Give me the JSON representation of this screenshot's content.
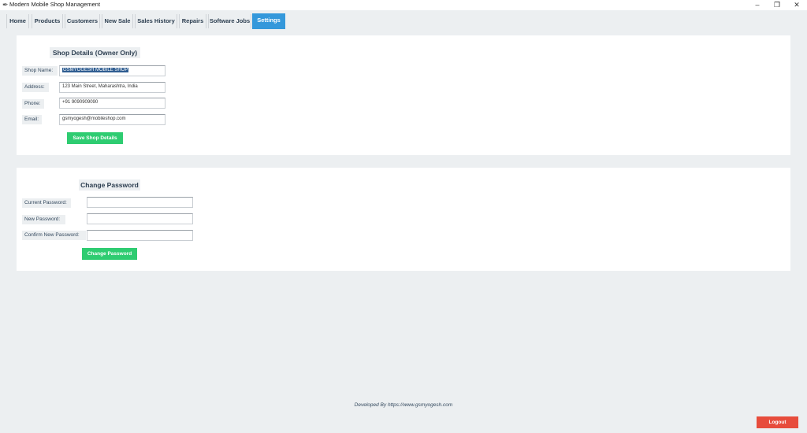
{
  "window": {
    "title": "Modern Mobile Shop Management",
    "app_icon": "feather-icon",
    "controls": {
      "minimize": "–",
      "restore": "❐",
      "close": "✕"
    }
  },
  "tabs": [
    {
      "label": "Home"
    },
    {
      "label": "Products"
    },
    {
      "label": "Customers"
    },
    {
      "label": "New Sale"
    },
    {
      "label": "Sales History"
    },
    {
      "label": "Repairs"
    },
    {
      "label": "Software Jobs"
    },
    {
      "label": "Settings",
      "active": true
    }
  ],
  "shop_details": {
    "title": "Shop Details (Owner Only)",
    "fields": [
      {
        "label": "Shop Name:",
        "value": "GSMYOGESH MOBILE SHOP",
        "selected": true
      },
      {
        "label": "Address:",
        "value": "123 Main Street, Maharashtra, India"
      },
      {
        "label": "Phone:",
        "value": "+91 9090909090"
      },
      {
        "label": "Email:",
        "value": "gsmyogesh@mobileshop.com"
      }
    ],
    "save_label": "Save Shop Details"
  },
  "change_password": {
    "title": "Change Password",
    "fields": [
      {
        "label": "Current Password:",
        "value": ""
      },
      {
        "label": "New Password:",
        "value": ""
      },
      {
        "label": "Confirm New Password:",
        "value": ""
      }
    ],
    "button_label": "Change Password"
  },
  "footer": {
    "credit": "Developed By https://www.gsmyogesh.com",
    "logout_label": "Logout"
  },
  "colors": {
    "accent": "#3498db",
    "success": "#2ecc71",
    "danger": "#e74c3c",
    "background": "#eceff1"
  }
}
